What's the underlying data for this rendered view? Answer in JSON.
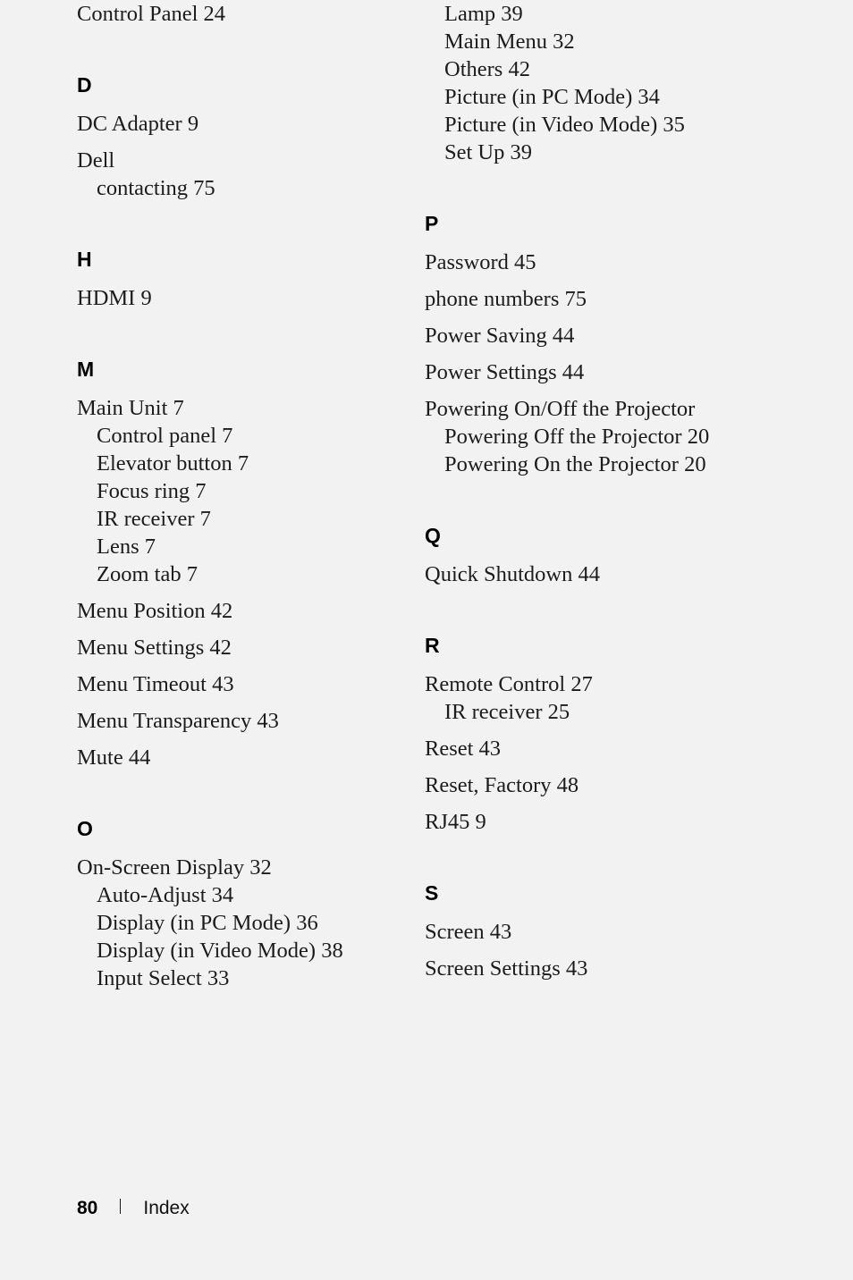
{
  "page": {
    "background_color": "#f2f2f2",
    "text_color": "#1c1c1c"
  },
  "footer": {
    "page_number": "80",
    "section_label": "Index",
    "separator": "vertical-bar"
  },
  "index": {
    "left_column": [
      {
        "kind": "entries",
        "items": [
          {
            "text": "Control Panel 24",
            "level": "main"
          }
        ]
      },
      {
        "kind": "letter-group",
        "letter": "D",
        "items": [
          {
            "text": "DC Adapter 9",
            "level": "main"
          },
          {
            "text": "Dell",
            "level": "main"
          },
          {
            "text": "contacting 75",
            "level": "sub"
          }
        ]
      },
      {
        "kind": "letter-group",
        "letter": "H",
        "items": [
          {
            "text": "HDMI 9",
            "level": "main"
          }
        ]
      },
      {
        "kind": "letter-group",
        "letter": "M",
        "items": [
          {
            "text": "Main Unit 7",
            "level": "main"
          },
          {
            "text": "Control panel 7",
            "level": "sub"
          },
          {
            "text": "Elevator button 7",
            "level": "sub"
          },
          {
            "text": "Focus ring 7",
            "level": "sub"
          },
          {
            "text": "IR receiver 7",
            "level": "sub"
          },
          {
            "text": "Lens 7",
            "level": "sub"
          },
          {
            "text": "Zoom tab 7",
            "level": "sub"
          },
          {
            "text": "Menu Position 42",
            "level": "main"
          },
          {
            "text": "Menu Settings 42",
            "level": "main"
          },
          {
            "text": "Menu Timeout 43",
            "level": "main"
          },
          {
            "text": "Menu Transparency 43",
            "level": "main"
          },
          {
            "text": "Mute 44",
            "level": "main"
          }
        ]
      },
      {
        "kind": "letter-group",
        "letter": "O",
        "items": [
          {
            "text": "On-Screen Display 32",
            "level": "main"
          },
          {
            "text": "Auto-Adjust 34",
            "level": "sub"
          },
          {
            "text": "Display (in PC Mode) 36",
            "level": "sub"
          },
          {
            "text": "Display (in Video Mode) 38",
            "level": "sub"
          },
          {
            "text": "Input Select 33",
            "level": "sub"
          }
        ]
      }
    ],
    "right_column": [
      {
        "kind": "entries",
        "items": [
          {
            "text": "Lamp 39",
            "level": "sub"
          },
          {
            "text": "Main Menu 32",
            "level": "sub"
          },
          {
            "text": "Others 42",
            "level": "sub"
          },
          {
            "text": "Picture (in PC Mode) 34",
            "level": "sub"
          },
          {
            "text": "Picture (in Video Mode) 35",
            "level": "sub"
          },
          {
            "text": "Set Up 39",
            "level": "sub"
          }
        ]
      },
      {
        "kind": "letter-group",
        "letter": "P",
        "items": [
          {
            "text": "Password 45",
            "level": "main"
          },
          {
            "text": "phone numbers 75",
            "level": "main"
          },
          {
            "text": "Power Saving 44",
            "level": "main"
          },
          {
            "text": "Power Settings 44",
            "level": "main"
          },
          {
            "text": "Powering On/Off the Projector",
            "level": "main"
          },
          {
            "text": "Powering Off the Projector 20",
            "level": "sub"
          },
          {
            "text": "Powering On the Projector 20",
            "level": "sub"
          }
        ]
      },
      {
        "kind": "letter-group",
        "letter": "Q",
        "items": [
          {
            "text": "Quick Shutdown 44",
            "level": "main"
          }
        ]
      },
      {
        "kind": "letter-group",
        "letter": "R",
        "items": [
          {
            "text": "Remote Control 27",
            "level": "main"
          },
          {
            "text": "IR receiver 25",
            "level": "sub"
          },
          {
            "text": "Reset 43",
            "level": "main"
          },
          {
            "text": "Reset, Factory 48",
            "level": "main"
          },
          {
            "text": "RJ45 9",
            "level": "main"
          }
        ]
      },
      {
        "kind": "letter-group",
        "letter": "S",
        "items": [
          {
            "text": "Screen 43",
            "level": "main"
          },
          {
            "text": "Screen Settings 43",
            "level": "main"
          }
        ]
      }
    ]
  }
}
